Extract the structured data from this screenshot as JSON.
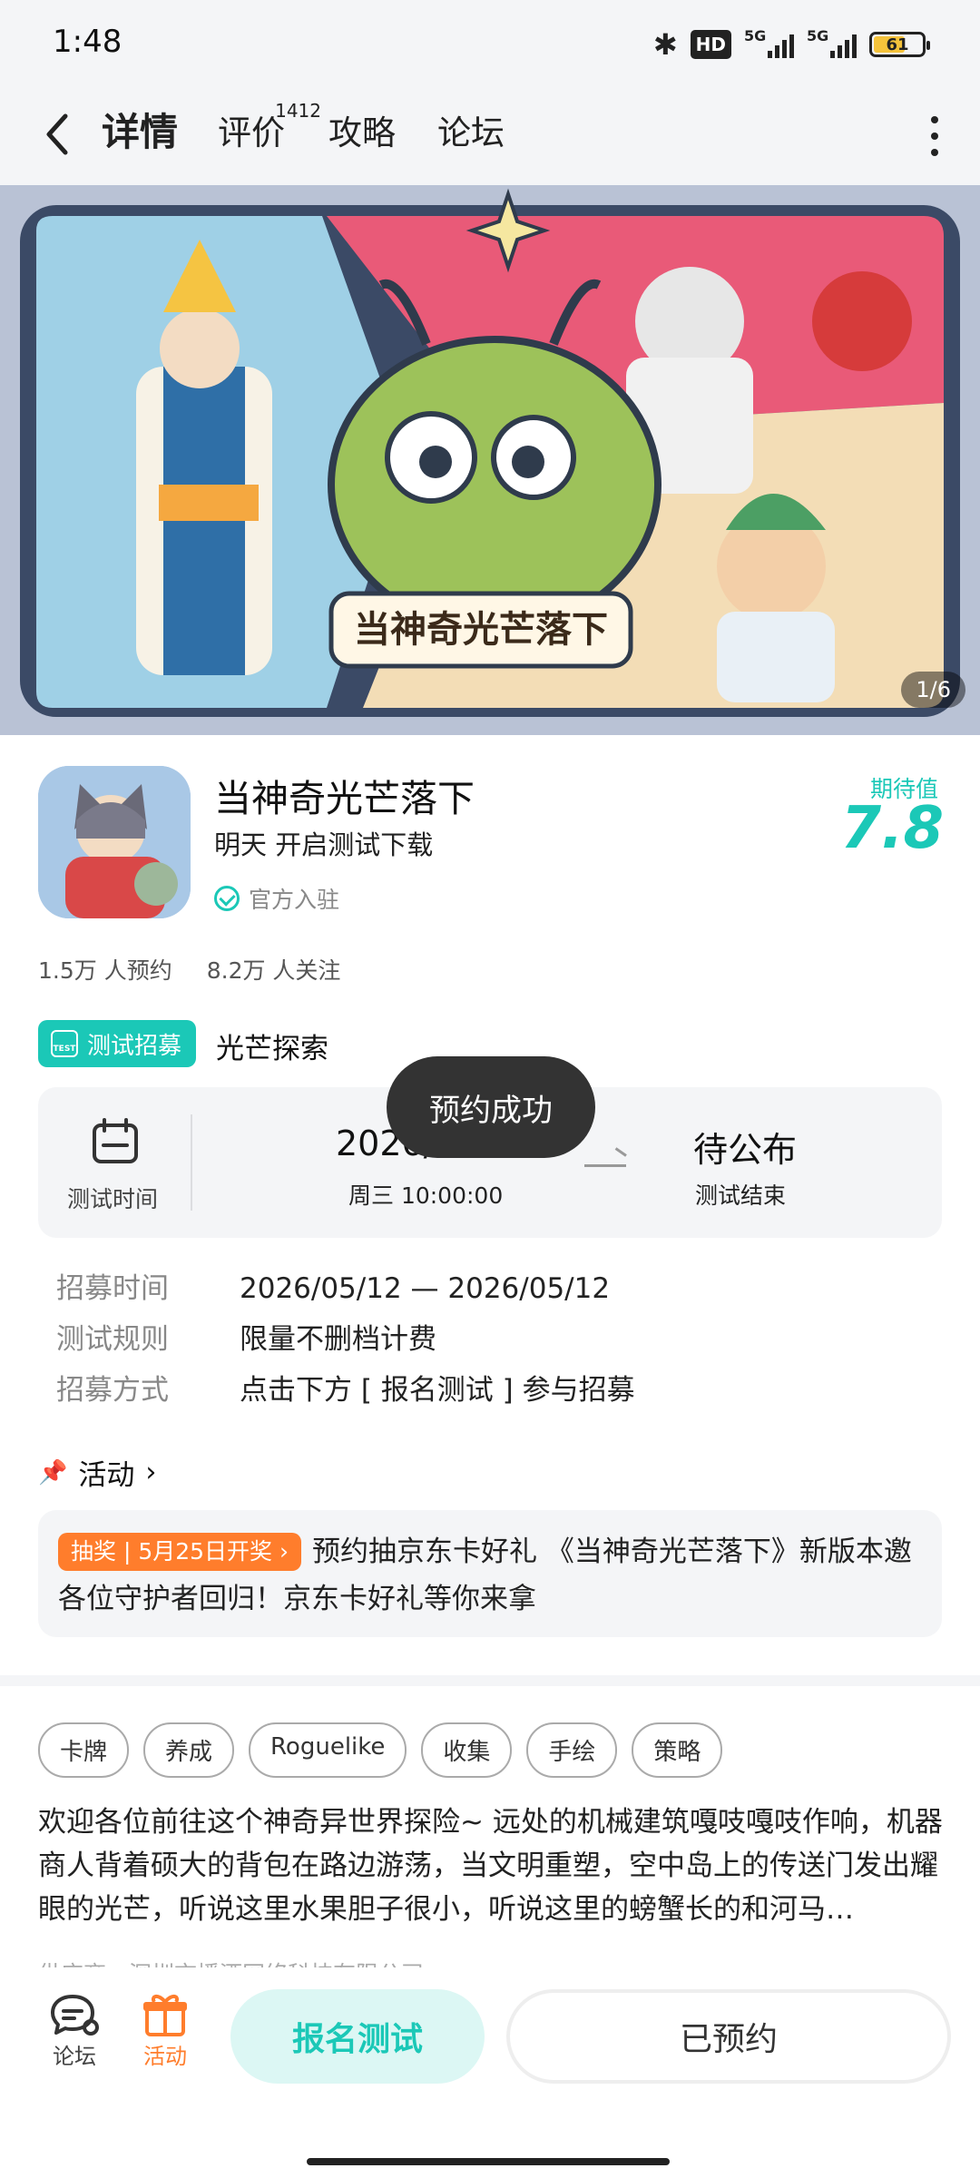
{
  "status": {
    "time": "1:48",
    "hd": "HD",
    "net1": "5G",
    "net2": "5G",
    "battery": "61"
  },
  "nav": {
    "tabs": [
      {
        "label": "详情"
      },
      {
        "label": "评价",
        "badge": "1412"
      },
      {
        "label": "攻略"
      },
      {
        "label": "论坛"
      }
    ]
  },
  "banner": {
    "logo_text": "当神奇光芒落下",
    "pager": "1/6"
  },
  "game": {
    "name": "当神奇光芒落下",
    "subtitle": "明天 开启测试下载",
    "official": "官方入驻",
    "expect_label": "期待值",
    "expect_value": "7.8",
    "reservations": "1.5万 人预约",
    "followers": "8.2万 人关注"
  },
  "test": {
    "tag_icon": "TEST",
    "tag": "测试招募",
    "name": "光芒探索",
    "time_label": "测试时间",
    "start_date": "2026/",
    "start_time": "周三  10:00:00",
    "end_value": "待公布",
    "end_label": "测试结束",
    "toast": "预约成功"
  },
  "rules": [
    {
      "k": "招募时间",
      "v": "2026/05/12 — 2026/05/12"
    },
    {
      "k": "测试规则",
      "v": "限量不删档计费"
    },
    {
      "k": "招募方式",
      "v": "点击下方 [ 报名测试 ] 参与招募"
    }
  ],
  "activity": {
    "title": "活动",
    "badge": "抽奖 | 5月25日开奖 ›",
    "text": "预约抽京东卡好礼 《当神奇光芒落下》新版本邀各位守护者回归！京东卡好礼等你来拿"
  },
  "tags": [
    "卡牌",
    "养成",
    "Roguelike",
    "收集",
    "手绘",
    "策略"
  ],
  "description": "欢迎各位前往这个神奇异世界探险~ 远处的机械建筑嘎吱嘎吱作响，机器商人背着硕大的背包在路边游荡，当文明重塑，空中岛上的传送门发出耀眼的光芒，听说这里水果胆子很小，听说这里的螃蟹长的和河马…",
  "provider": "供应商：深圳市播酒网络科技有限公司",
  "bottom": {
    "forum": "论坛",
    "activity": "活动",
    "signup": "报名测试",
    "reserved": "已预约"
  },
  "colors": {
    "accent": "#1bc8b7",
    "orange": "#ff7d2c",
    "panel": "#f4f5f7"
  }
}
